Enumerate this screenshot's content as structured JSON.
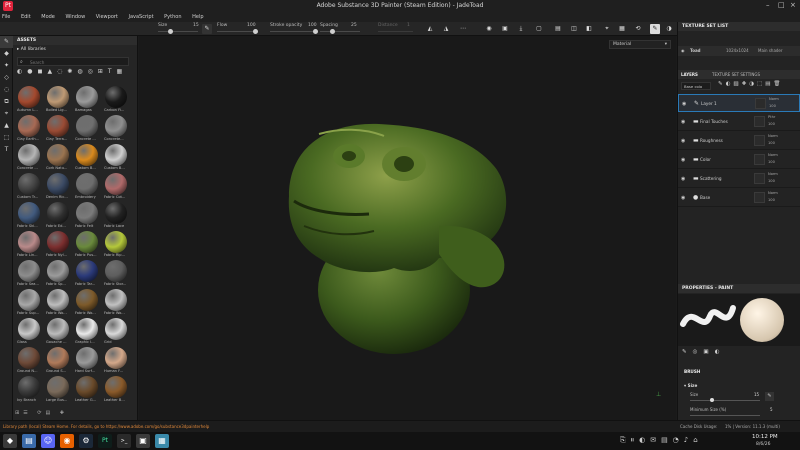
{
  "window": {
    "title": "Adobe Substance 3D Painter (Steam Edition) - JadeToad",
    "logo": "Pt"
  },
  "menu": [
    "File",
    "Edit",
    "Mode",
    "Window",
    "Viewport",
    "JavaScript",
    "Python",
    "Help"
  ],
  "toolbar": {
    "size_label": "Size",
    "size_value": "15",
    "flow_label": "Flow",
    "flow_value": "100",
    "stroke_opacity_label": "Stroke opacity",
    "stroke_opacity_value": "100",
    "spacing_label": "Spacing",
    "spacing_value": "25",
    "jitter_label": "Distance",
    "jitter_value": "1"
  },
  "assets": {
    "title": "ASSETS",
    "library": "All libraries",
    "search_placeholder": "Search",
    "items": [
      {
        "label": "Autumn L...",
        "color": "#a4492e"
      },
      {
        "label": "Boiled Lig...",
        "color": "#bf9a74"
      },
      {
        "label": "Bamagas",
        "color": "#9a9a9a"
      },
      {
        "label": "Carbon Fi...",
        "color": "#1a1a1a"
      },
      {
        "label": "Clay Earth...",
        "color": "#a86a54"
      },
      {
        "label": "Clay Terra...",
        "color": "#9a4b34"
      },
      {
        "label": "Concrete ...",
        "color": "#6f6f6f"
      },
      {
        "label": "Concrete...",
        "color": "#8f8f8f"
      },
      {
        "label": "Concrete ...",
        "color": "#b5b5b5"
      },
      {
        "label": "Cork Natu...",
        "color": "#9b7450"
      },
      {
        "label": "Custom B...",
        "color": "#d98a1e"
      },
      {
        "label": "Custom B...",
        "color": "#cfcfcf"
      },
      {
        "label": "Custom Tr...",
        "color": "#444444"
      },
      {
        "label": "Denim Ric...",
        "color": "#3b4a64"
      },
      {
        "label": "Embroidery",
        "color": "#6d6d6d"
      },
      {
        "label": "Fabric Cot...",
        "color": "#b06a6a"
      },
      {
        "label": "Fabric Ski...",
        "color": "#415a7e"
      },
      {
        "label": "Fabric Ed...",
        "color": "#2f2f2f"
      },
      {
        "label": "Fabric Felt",
        "color": "#7a7a7a"
      },
      {
        "label": "Fabric Lace",
        "color": "#222222"
      },
      {
        "label": "Fabric Lin...",
        "color": "#b98a8a"
      },
      {
        "label": "Fabric Nyl...",
        "color": "#7c2f2f"
      },
      {
        "label": "Fabric Pus...",
        "color": "#6a8a3c"
      },
      {
        "label": "Fabric Rip...",
        "color": "#b4c83a"
      },
      {
        "label": "Fabric Sea...",
        "color": "#8d8d8d"
      },
      {
        "label": "Fabric Sp...",
        "color": "#9b9b9b"
      },
      {
        "label": "Fabric Tar...",
        "color": "#2b3a7a"
      },
      {
        "label": "Fabric Stor...",
        "color": "#5e5e5e"
      },
      {
        "label": "Fabric Sup...",
        "color": "#a8a8a8"
      },
      {
        "label": "Fabric Wo...",
        "color": "#bdbdbd"
      },
      {
        "label": "Fabric Wo...",
        "color": "#7d5a2a"
      },
      {
        "label": "Fabric Wo...",
        "color": "#c1c1c1"
      },
      {
        "label": "Glass",
        "color": "#c8c8c8"
      },
      {
        "label": "Gouache ...",
        "color": "#bcbcbc"
      },
      {
        "label": "Graphic I...",
        "color": "#e9e9e9"
      },
      {
        "label": "Grid",
        "color": "#d9d9d9"
      },
      {
        "label": "Ground N...",
        "color": "#6e4a38"
      },
      {
        "label": "Ground S...",
        "color": "#b07a5a"
      },
      {
        "label": "Hard Surf...",
        "color": "#9a9a9a"
      },
      {
        "label": "Human F...",
        "color": "#d4a88a"
      },
      {
        "label": "Ivy Branch",
        "color": "#3a3a3a"
      },
      {
        "label": "Large Bus...",
        "color": "#7a6a5a"
      },
      {
        "label": "Leather G...",
        "color": "#6a4a2a"
      },
      {
        "label": "Leather B...",
        "color": "#8a5a2a"
      }
    ]
  },
  "viewport": {
    "material_dropdown": "Material"
  },
  "texture_set_list": {
    "title": "TEXTURE SET LIST",
    "row_name": "Toad",
    "row_res": "1024x1024",
    "row_shader": "Main shader"
  },
  "layers": {
    "tab_layers": "LAYERS",
    "tab_tss": "TEXTURE SET SETTINGS",
    "channel": "Base colo",
    "items": [
      {
        "name": "Layer 1",
        "mode": "Norm",
        "opacity": "100",
        "kind": "paint"
      },
      {
        "name": "Final Touches",
        "mode": "Pthr",
        "opacity": "100",
        "kind": "folder"
      },
      {
        "name": "Roughness",
        "mode": "Norm",
        "opacity": "100",
        "kind": "folder"
      },
      {
        "name": "Color",
        "mode": "Norm",
        "opacity": "100",
        "kind": "folder"
      },
      {
        "name": "Scattering",
        "mode": "Norm",
        "opacity": "100",
        "kind": "folder"
      },
      {
        "name": "Base",
        "mode": "Norm",
        "opacity": "100",
        "kind": "fill"
      }
    ]
  },
  "properties": {
    "title": "PROPERTIES - PAINT",
    "brush_section": "BRUSH",
    "size_label": "Size",
    "size_row_label": "Size",
    "size_value": "15",
    "min_size_label": "Minimum Size (%)",
    "min_size_value": "5"
  },
  "status": {
    "message": "Library path (local) Steam Home. For details, go to https://www.adobe.com/go/substance3dpainterhelp",
    "cache": "Cache Disk Usage:",
    "version": "1% | Version: 11.1.3 (multi)"
  },
  "taskbar": {
    "time": "10:12 PM",
    "date": "8/6/26",
    "icons": [
      {
        "name": "start",
        "color": "#3a3a3a"
      },
      {
        "name": "files",
        "color": "#3a6aa8"
      },
      {
        "name": "discord",
        "color": "#5865f2"
      },
      {
        "name": "firefox",
        "color": "#e66000"
      },
      {
        "name": "steam",
        "color": "#1b2838"
      },
      {
        "name": "painter",
        "color": "#0e1d1a"
      },
      {
        "name": "terminal",
        "color": "#2a2a2a"
      },
      {
        "name": "app",
        "color": "#3a3a3a"
      },
      {
        "name": "active",
        "color": "#3a8aaa"
      }
    ]
  },
  "accent": "#2a7ab8"
}
